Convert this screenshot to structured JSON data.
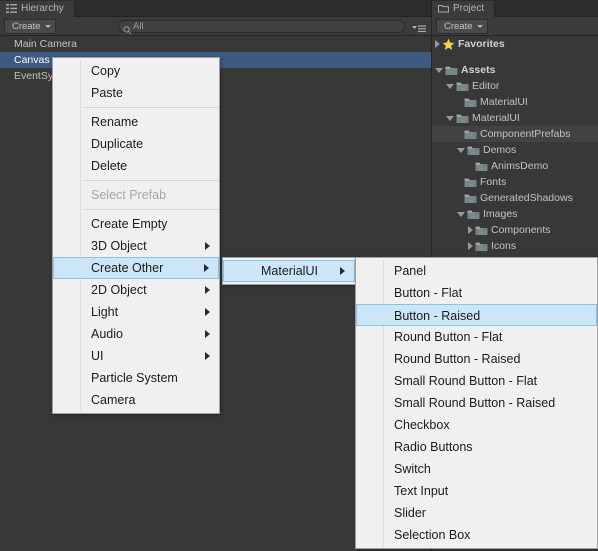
{
  "hierarchy": {
    "tab_label": "Hierarchy",
    "tab_icon": "hierarchy-icon",
    "create_label": "Create",
    "search_placeholder": "All",
    "search_value": "All",
    "search_icon": "search-icon",
    "options_icon": "hamburger-menu-icon",
    "rows": [
      {
        "label": "Main Camera",
        "selected": false
      },
      {
        "label": "Canvas",
        "selected": true
      },
      {
        "label": "EventSystem",
        "selected": false
      }
    ]
  },
  "project": {
    "tab_label": "Project",
    "tab_icon": "folder-icon",
    "create_label": "Create",
    "rows": [
      {
        "label": "Favorites",
        "indent": 0,
        "tri": "closed",
        "icon": "star-icon",
        "bold": true,
        "highlight": false
      },
      {
        "spacer": true
      },
      {
        "label": "Assets",
        "indent": 0,
        "tri": "open",
        "icon": "folder-icon",
        "bold": true,
        "highlight": false
      },
      {
        "label": "Editor",
        "indent": 1,
        "tri": "open",
        "icon": "folder-icon",
        "bold": false,
        "highlight": false
      },
      {
        "label": "MaterialUI",
        "indent": 2,
        "tri": "none",
        "icon": "folder-icon",
        "bold": false,
        "highlight": false
      },
      {
        "label": "MaterialUI",
        "indent": 1,
        "tri": "open",
        "icon": "folder-icon",
        "bold": false,
        "highlight": false
      },
      {
        "label": "ComponentPrefabs",
        "indent": 2,
        "tri": "none",
        "icon": "folder-icon",
        "bold": false,
        "highlight": true
      },
      {
        "label": "Demos",
        "indent": 2,
        "tri": "open",
        "icon": "folder-icon",
        "bold": false,
        "highlight": false
      },
      {
        "label": "AnimsDemo",
        "indent": 3,
        "tri": "none",
        "icon": "folder-icon",
        "bold": false,
        "highlight": false
      },
      {
        "label": "Fonts",
        "indent": 2,
        "tri": "none",
        "icon": "folder-icon",
        "bold": false,
        "highlight": false
      },
      {
        "label": "GeneratedShadows",
        "indent": 2,
        "tri": "none",
        "icon": "folder-icon",
        "bold": false,
        "highlight": false
      },
      {
        "label": "Images",
        "indent": 2,
        "tri": "open",
        "icon": "folder-icon",
        "bold": false,
        "highlight": false
      },
      {
        "label": "Components",
        "indent": 3,
        "tri": "closed",
        "icon": "folder-icon",
        "bold": false,
        "highlight": false
      },
      {
        "label": "Icons",
        "indent": 3,
        "tri": "closed",
        "icon": "folder-icon",
        "bold": false,
        "highlight": false
      }
    ]
  },
  "context_menu": {
    "items": [
      {
        "label": "Copy",
        "type": "item"
      },
      {
        "label": "Paste",
        "type": "item"
      },
      {
        "type": "separator"
      },
      {
        "label": "Rename",
        "type": "item"
      },
      {
        "label": "Duplicate",
        "type": "item"
      },
      {
        "label": "Delete",
        "type": "item"
      },
      {
        "type": "separator"
      },
      {
        "label": "Select Prefab",
        "type": "item",
        "disabled": true
      },
      {
        "type": "separator"
      },
      {
        "label": "Create Empty",
        "type": "item"
      },
      {
        "label": "3D Object",
        "type": "item",
        "submenu": true
      },
      {
        "label": "Create Other",
        "type": "item",
        "submenu": true,
        "highlight": true
      },
      {
        "label": "2D Object",
        "type": "item",
        "submenu": true
      },
      {
        "label": "Light",
        "type": "item",
        "submenu": true
      },
      {
        "label": "Audio",
        "type": "item",
        "submenu": true
      },
      {
        "label": "UI",
        "type": "item",
        "submenu": true
      },
      {
        "label": "Particle System",
        "type": "item"
      },
      {
        "label": "Camera",
        "type": "item"
      }
    ]
  },
  "create_other_menu": {
    "items": [
      {
        "label": "MaterialUI",
        "type": "item",
        "submenu": true,
        "highlight": true
      }
    ]
  },
  "materialui_menu": {
    "items": [
      {
        "label": "Panel",
        "type": "item"
      },
      {
        "label": "Button - Flat",
        "type": "item"
      },
      {
        "label": "Button - Raised",
        "type": "item",
        "highlight": true
      },
      {
        "label": "Round Button - Flat",
        "type": "item"
      },
      {
        "label": "Round Button - Raised",
        "type": "item"
      },
      {
        "label": "Small Round Button - Flat",
        "type": "item"
      },
      {
        "label": "Small Round Button - Raised",
        "type": "item"
      },
      {
        "label": "Checkbox",
        "type": "item"
      },
      {
        "label": "Radio Buttons",
        "type": "item"
      },
      {
        "label": "Switch",
        "type": "item"
      },
      {
        "label": "Text Input",
        "type": "item"
      },
      {
        "label": "Slider",
        "type": "item"
      },
      {
        "label": "Selection Box",
        "type": "item"
      }
    ]
  },
  "colors": {
    "background": "#383838",
    "panel": "#3b3b3b",
    "selection_blue": "#3d5a80",
    "menu_bg": "#f0f0f0",
    "menu_highlight": "#cde6f7",
    "menu_highlight_border": "#89c4e8",
    "text": "#c3c3c3",
    "star_yellow": "#f5d442"
  }
}
